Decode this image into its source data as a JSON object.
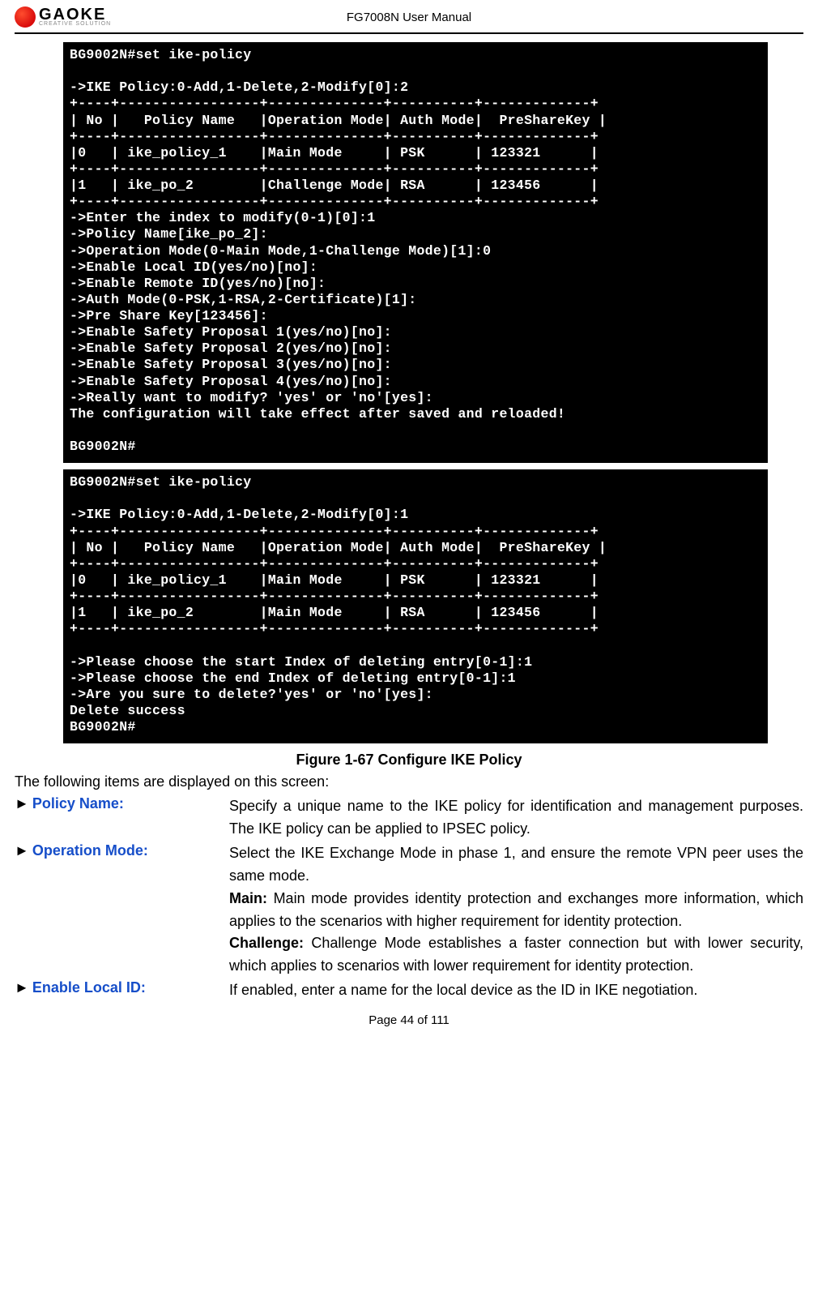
{
  "header": {
    "logo_text": "GAOKE",
    "logo_sub": "CREATIVE SOLUTION",
    "title": "FG7008N User Manual"
  },
  "terminal1": "BG9002N#set ike-policy\n\n->IKE Policy:0-Add,1-Delete,2-Modify[0]:2\n+----+-----------------+--------------+----------+-------------+\n| No |   Policy Name   |Operation Mode| Auth Mode|  PreShareKey |\n+----+-----------------+--------------+----------+-------------+\n|0   | ike_policy_1    |Main Mode     | PSK      | 123321      |\n+----+-----------------+--------------+----------+-------------+\n|1   | ike_po_2        |Challenge Mode| RSA      | 123456      |\n+----+-----------------+--------------+----------+-------------+\n->Enter the index to modify(0-1)[0]:1\n->Policy Name[ike_po_2]:\n->Operation Mode(0-Main Mode,1-Challenge Mode)[1]:0\n->Enable Local ID(yes/no)[no]:\n->Enable Remote ID(yes/no)[no]:\n->Auth Mode(0-PSK,1-RSA,2-Certificate)[1]:\n->Pre Share Key[123456]:\n->Enable Safety Proposal 1(yes/no)[no]:\n->Enable Safety Proposal 2(yes/no)[no]:\n->Enable Safety Proposal 3(yes/no)[no]:\n->Enable Safety Proposal 4(yes/no)[no]:\n->Really want to modify? 'yes' or 'no'[yes]:\nThe configuration will take effect after saved and reloaded!\n\nBG9002N#",
  "terminal2": "BG9002N#set ike-policy\n\n->IKE Policy:0-Add,1-Delete,2-Modify[0]:1\n+----+-----------------+--------------+----------+-------------+\n| No |   Policy Name   |Operation Mode| Auth Mode|  PreShareKey |\n+----+-----------------+--------------+----------+-------------+\n|0   | ike_policy_1    |Main Mode     | PSK      | 123321      |\n+----+-----------------+--------------+----------+-------------+\n|1   | ike_po_2        |Main Mode     | RSA      | 123456      |\n+----+-----------------+--------------+----------+-------------+\n\n->Please choose the start Index of deleting entry[0-1]:1\n->Please choose the end Index of deleting entry[0-1]:1\n->Are you sure to delete?'yes' or 'no'[yes]:\nDelete success\nBG9002N#",
  "caption": "Figure 1-67    Configure IKE Policy",
  "intro": "The following items are displayed on this screen:",
  "items": {
    "policy_name": {
      "label": "Policy Name:",
      "desc": "Specify a unique name to the IKE policy for identification and management purposes. The IKE policy can be applied to IPSEC policy."
    },
    "operation_mode": {
      "label": "Operation Mode:",
      "desc_intro": "Select the IKE Exchange Mode in phase 1, and ensure the remote VPN peer uses the same mode.",
      "main_label": "Main:",
      "main_desc": " Main mode provides identity protection and exchanges more information, which applies to the scenarios with higher requirement for identity protection.",
      "challenge_label": "Challenge:",
      "challenge_desc": " Challenge Mode establishes a faster connection but with lower security, which applies to scenarios with lower requirement for identity protection."
    },
    "enable_local_id": {
      "label": "Enable Local ID:",
      "desc": "If enabled, enter a name for the local device as the ID in IKE negotiation."
    }
  },
  "footer": "Page 44 of 111"
}
